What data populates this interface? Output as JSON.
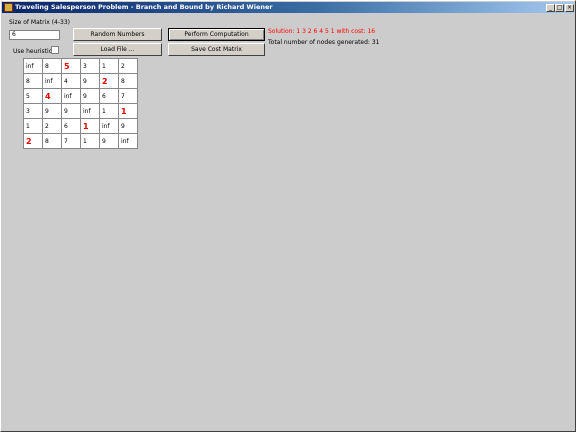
{
  "window": {
    "title": "Traveling Salesperson Problem - Branch and Bound by Richard Wiener",
    "controls": {
      "minimize": "_",
      "maximize": "□",
      "close": "×"
    }
  },
  "controls": {
    "size_label": "Size of Matrix (4-33)",
    "size_value": "6",
    "heuristic_label": "Use heuristic",
    "random_numbers": "Random Numbers",
    "load_file": "Load File ...",
    "perform_computation": "Perform Computation",
    "save_cost_matrix": "Save Cost Matrix"
  },
  "results": {
    "solution": "Solution: 1 3 2 6 4 5 1 with cost: 16",
    "nodes": "Total number of nodes generated: 31"
  },
  "colors": {
    "highlight": "#e00000",
    "title_start": "#0a246a"
  },
  "matrix": {
    "rows": [
      [
        "inf",
        "8",
        "5",
        "3",
        "1",
        "2"
      ],
      [
        "8",
        "inf",
        "4",
        "9",
        "2",
        "8"
      ],
      [
        "5",
        "4",
        "inf",
        "9",
        "6",
        "7"
      ],
      [
        "3",
        "9",
        "9",
        "inf",
        "1",
        "1"
      ],
      [
        "1",
        "2",
        "6",
        "1",
        "inf",
        "9"
      ],
      [
        "2",
        "8",
        "7",
        "1",
        "9",
        "inf"
      ]
    ],
    "highlighted": [
      [
        0,
        2
      ],
      [
        1,
        4
      ],
      [
        2,
        1
      ],
      [
        3,
        5
      ],
      [
        4,
        3
      ],
      [
        5,
        0
      ]
    ]
  }
}
